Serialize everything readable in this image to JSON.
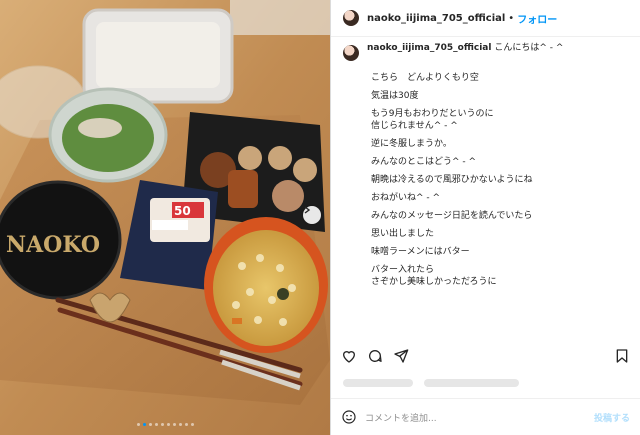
{
  "post": {
    "username": "naoko_iijima_705_official",
    "separator": "•",
    "follow_label": "フォロー",
    "caption_intro": "こんにちは^ - ^",
    "caption_lines": [
      "こちら　どんよりくもり空",
      "気温は30度",
      "もう9月もおわりだというのに",
      "信じられません^ - ^",
      "逆に冬服しまうか。",
      "みんなのとこはどう^ - ^",
      "朝晩は冷えるので風邪ひかないようにね",
      "おねがいね^ - ^",
      "みんなのメッセージ日記を読んでいたら",
      "思い出しました",
      "味噌ラーメンにはバター",
      "バター入れたら",
      "さぞかし美味しかっただろうに"
    ],
    "comment_placeholder": "コメントを追加...",
    "post_label": "投稿する",
    "photo_text": "NAOKO",
    "price_tag": "50"
  },
  "icons": [
    "more-icon",
    "heart-icon",
    "comment-icon",
    "share-icon",
    "bookmark-icon",
    "emoji-icon",
    "chevron-right-icon"
  ],
  "colors": {
    "accent": "#0095f6",
    "text": "#262626",
    "muted": "#8e8e8e"
  },
  "carousel": {
    "count": 10,
    "active": 2
  }
}
